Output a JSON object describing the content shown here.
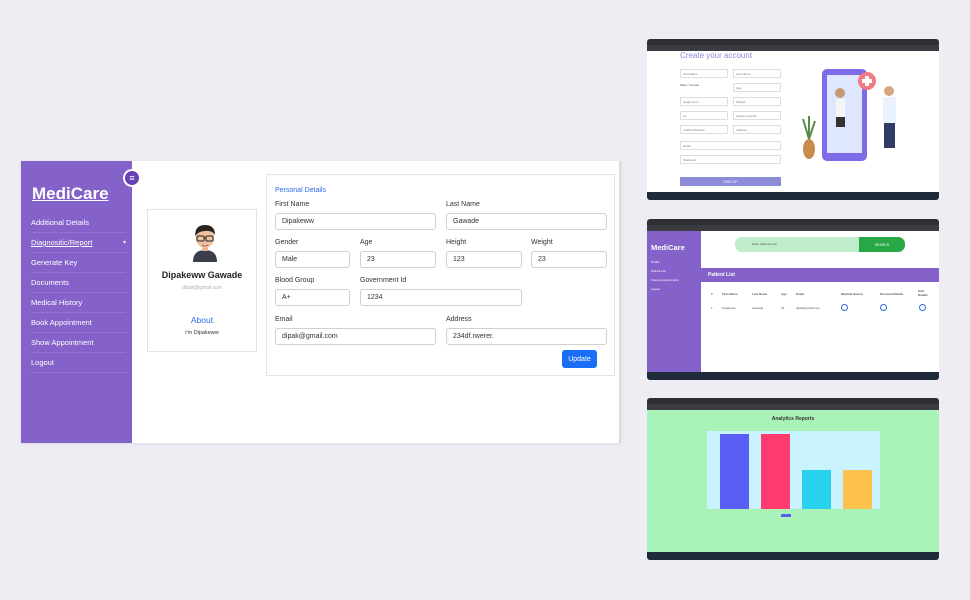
{
  "sidebar": {
    "brand": "MediCare",
    "items": [
      {
        "label": "Additional Details"
      },
      {
        "label": "Diagnositic/Report",
        "caret": "▾"
      },
      {
        "label": "Generate Key"
      },
      {
        "label": "Documents"
      },
      {
        "label": "Medical History"
      },
      {
        "label": "Book Appointment"
      },
      {
        "label": "Show Appointment"
      },
      {
        "label": "Logout"
      }
    ],
    "toggle_icon": "≡"
  },
  "profile": {
    "name": "Dipakeww Gawade",
    "email": "dipak@gmail.com",
    "about_title": "About",
    "bio": "i'm Dipakeww"
  },
  "form": {
    "section_title": "Personal Details",
    "first_name": {
      "label": "First Name",
      "value": "Dipakeww"
    },
    "last_name": {
      "label": "Last Name",
      "value": "Gawade"
    },
    "gender": {
      "label": "Gender",
      "value": "Male"
    },
    "age": {
      "label": "Age",
      "value": "23"
    },
    "height": {
      "label": "Height",
      "value": "123"
    },
    "weight": {
      "label": "Weight",
      "value": "23"
    },
    "blood_group": {
      "label": "Blood Group",
      "value": "A+"
    },
    "government_id": {
      "label": "Government Id",
      "value": "1234"
    },
    "email": {
      "label": "Email",
      "value": "dipak@gmail.com"
    },
    "address": {
      "label": "Address",
      "value": "234df.rwerer."
    },
    "update_label": "Update"
  },
  "thumb_signup": {
    "title": "Create your account",
    "fields": [
      "First Name",
      "Last Name",
      "Male",
      "Female",
      "Age",
      "Height (cm)",
      "Weight",
      "A+",
      "Government ID",
      "Andhra Pradesh",
      "Address",
      "Email",
      "Password"
    ],
    "button": "SIGN UP"
  },
  "thumb_patients": {
    "brand": "MediCare",
    "search_placeholder": "Enter Patient's key",
    "search_button": "SEARCH",
    "nav": [
      "Profile",
      "Patient List",
      "Future Appointments",
      "Logout"
    ],
    "list_title": "Patient List",
    "columns": [
      "#",
      "First Name",
      "Last Name",
      "Age",
      "Email",
      "Medical History",
      "Personal Details",
      "Add Details"
    ],
    "rows": [
      [
        "1",
        "Dipakeww",
        "Gawade",
        "23",
        "dipak@gmail.com"
      ]
    ]
  },
  "thumb_analytics": {
    "title": "Analytics Reports",
    "colors": {
      "bar1": "#5b5ef5",
      "bar2": "#ff3a6e",
      "bar3": "#28d2ef",
      "bar4": "#ffc14d"
    }
  },
  "colors": {
    "sidebar": "#8462c9",
    "accent": "#1a6ef5",
    "link": "#2e6be6"
  }
}
